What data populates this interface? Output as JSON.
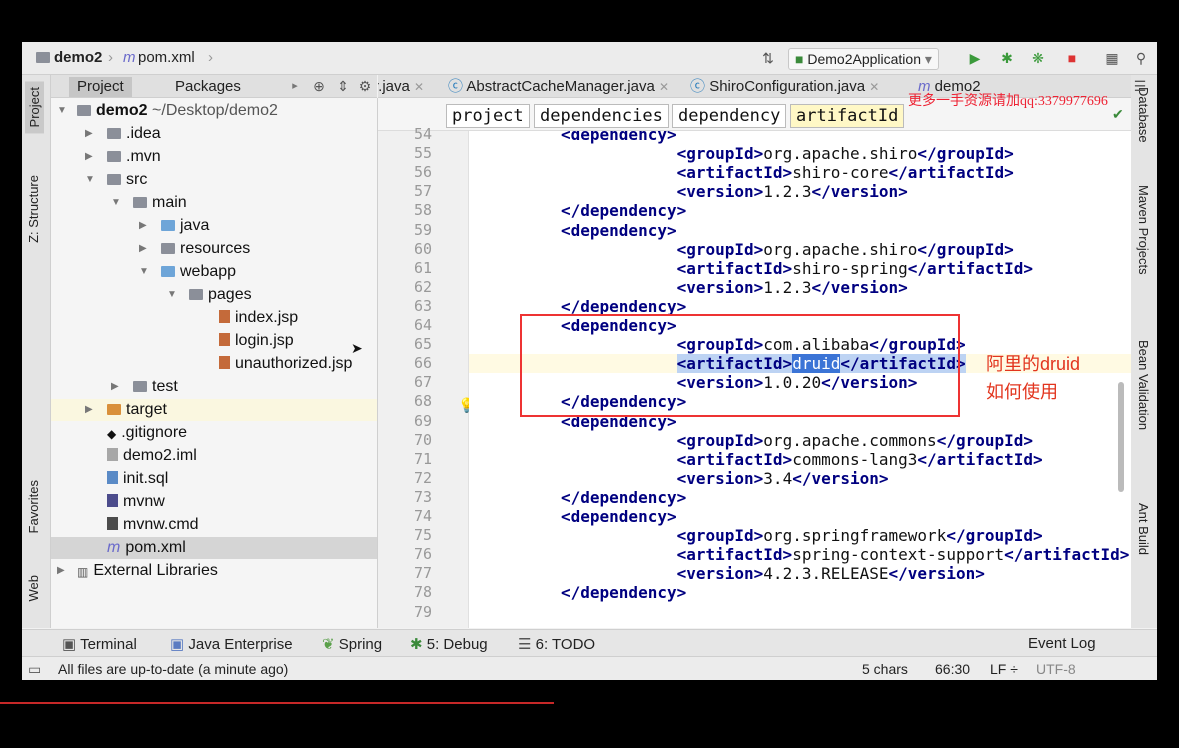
{
  "breadcrumb": {
    "project": "demo2",
    "file": "pom.xml"
  },
  "run_config": "Demo2Application",
  "left_tabs": [
    "Project",
    "Z: Structure",
    "Favorites",
    "Web"
  ],
  "right_tabs": [
    "Database",
    "Maven Projects",
    "Bean Validation",
    "Ant Build"
  ],
  "panel_tabs": [
    "Project",
    "Packages"
  ],
  "editor_tabs": [
    "r.java",
    "AbstractCacheManager.java",
    "ShiroConfiguration.java",
    "demo2"
  ],
  "xml_crumbs": [
    "project",
    "dependencies",
    "dependency",
    "artifactId"
  ],
  "tree": [
    {
      "label": "demo2",
      "extra": "~/Desktop/demo2"
    },
    {
      "label": ".idea"
    },
    {
      "label": ".mvn"
    },
    {
      "label": "src"
    },
    {
      "label": "main"
    },
    {
      "label": "java"
    },
    {
      "label": "resources"
    },
    {
      "label": "webapp"
    },
    {
      "label": "pages"
    },
    {
      "label": "index.jsp"
    },
    {
      "label": "login.jsp"
    },
    {
      "label": "unauthorized.jsp"
    },
    {
      "label": "test"
    },
    {
      "label": "target"
    },
    {
      "label": ".gitignore"
    },
    {
      "label": "demo2.iml"
    },
    {
      "label": "init.sql"
    },
    {
      "label": "mvnw"
    },
    {
      "label": "mvnw.cmd"
    },
    {
      "label": "pom.xml"
    },
    {
      "label": "External Libraries"
    }
  ],
  "code": {
    "line_numbers": [
      "54",
      "55",
      "56",
      "57",
      "58",
      "59",
      "60",
      "61",
      "62",
      "63",
      "64",
      "65",
      "66",
      "67",
      "68",
      "69",
      "70",
      "71",
      "72",
      "73",
      "74",
      "75",
      "76",
      "77",
      "78",
      "79"
    ],
    "lines": [
      {
        "indent": "  ",
        "open": "dependency",
        "text": "",
        "close": ""
      },
      {
        "indent": "    ",
        "open": "groupId",
        "text": "org.apache.shiro",
        "close": "groupId"
      },
      {
        "indent": "    ",
        "open": "artifactId",
        "text": "shiro-core",
        "close": "artifactId"
      },
      {
        "indent": "    ",
        "open": "version",
        "text": "1.2.3",
        "close": "version"
      },
      {
        "indent": "  ",
        "open": "",
        "text": "",
        "close": "dependency"
      },
      {
        "indent": "  ",
        "open": "dependency",
        "text": "",
        "close": ""
      },
      {
        "indent": "    ",
        "open": "groupId",
        "text": "org.apache.shiro",
        "close": "groupId"
      },
      {
        "indent": "    ",
        "open": "artifactId",
        "text": "shiro-spring",
        "close": "artifactId"
      },
      {
        "indent": "    ",
        "open": "version",
        "text": "1.2.3",
        "close": "version"
      },
      {
        "indent": "  ",
        "open": "",
        "text": "",
        "close": "dependency"
      },
      {
        "indent": "  ",
        "open": "dependency",
        "text": "",
        "close": ""
      },
      {
        "indent": "    ",
        "open": "groupId",
        "text": "com.alibaba",
        "close": "groupId"
      },
      {
        "indent": "    ",
        "open": "artifactId",
        "text": "druid",
        "close": "artifactId"
      },
      {
        "indent": "    ",
        "open": "version",
        "text": "1.0.20",
        "close": "version"
      },
      {
        "indent": "  ",
        "open": "",
        "text": "",
        "close": "dependency"
      },
      {
        "indent": "  ",
        "open": "dependency",
        "text": "",
        "close": ""
      },
      {
        "indent": "    ",
        "open": "groupId",
        "text": "org.apache.commons",
        "close": "groupId"
      },
      {
        "indent": "    ",
        "open": "artifactId",
        "text": "commons-lang3",
        "close": "artifactId"
      },
      {
        "indent": "    ",
        "open": "version",
        "text": "3.4",
        "close": "version"
      },
      {
        "indent": "  ",
        "open": "",
        "text": "",
        "close": "dependency"
      },
      {
        "indent": "  ",
        "open": "dependency",
        "text": "",
        "close": ""
      },
      {
        "indent": "    ",
        "open": "groupId",
        "text": "org.springframework",
        "close": "groupId"
      },
      {
        "indent": "    ",
        "open": "artifactId",
        "text": "spring-context-support",
        "close": "artifactId"
      },
      {
        "indent": "    ",
        "open": "version",
        "text": "4.2.3.RELEASE",
        "close": "version"
      },
      {
        "indent": "  ",
        "open": "",
        "text": "",
        "close": "dependency"
      },
      {
        "indent": "",
        "open": "",
        "text": "",
        "close": ""
      }
    ]
  },
  "annotation": {
    "line1": "阿里的druid",
    "line2": "如何使用"
  },
  "watermark": "更多一手资源请加qq:3379977696",
  "tool_windows": [
    "Terminal",
    "Java Enterprise",
    "Spring",
    "5: Debug",
    "6: TODO",
    "Event Log"
  ],
  "status": {
    "message": "All files are up-to-date (a minute ago)",
    "chars": "5 chars",
    "position": "66:30",
    "line_sep": "LF ÷",
    "encoding": "UTF-8"
  },
  "video_progress": 0.47,
  "colors": {
    "tag": "#000080",
    "highlight_box": "#e33333",
    "annotation": "#e2341d",
    "selection": "#3b74d6"
  }
}
